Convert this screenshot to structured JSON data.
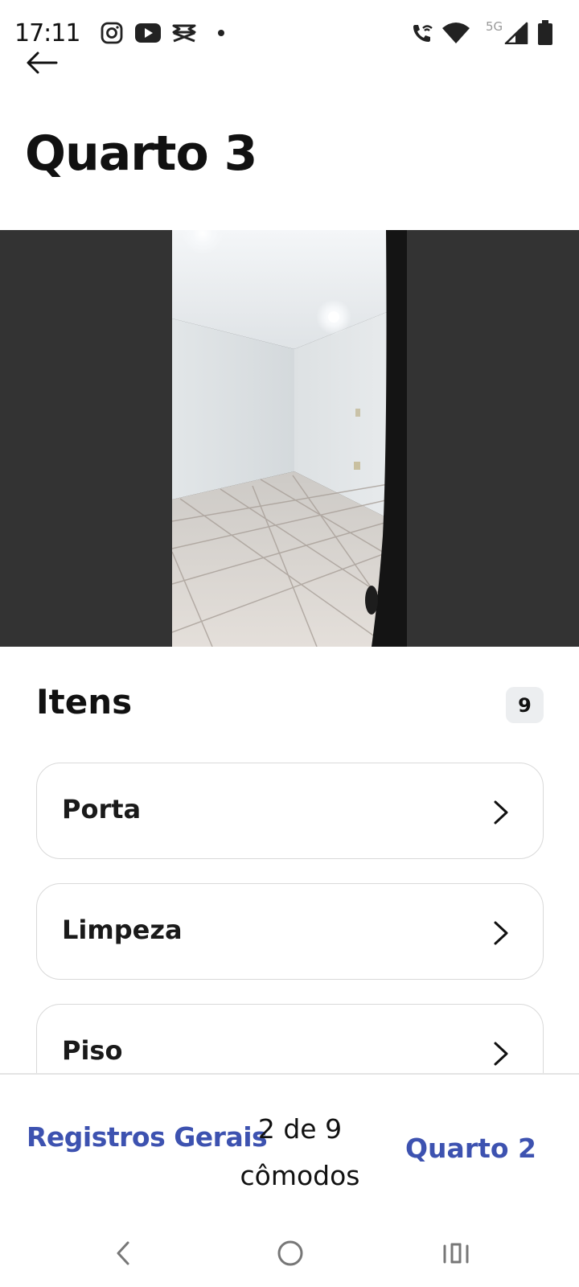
{
  "status_bar": {
    "time": "17:11",
    "network": "5G",
    "left_icons": [
      "instagram-icon",
      "youtube-icon",
      "capcut-icon",
      "notification-dot-icon"
    ],
    "right_icons": [
      "wifi-calling-icon",
      "wifi-icon",
      "signal-icon",
      "battery-icon"
    ]
  },
  "header": {
    "back_icon": "arrow-left-icon",
    "title": "Quarto 3"
  },
  "photo": {
    "description_icon": "room-photo",
    "background_color": "#333333"
  },
  "items_section": {
    "title": "Itens",
    "count": "9",
    "items": [
      {
        "label": "Porta"
      },
      {
        "label": "Limpeza"
      },
      {
        "label": "Piso"
      }
    ]
  },
  "footer_nav": {
    "prev_label": "Registros Gerais",
    "progress_line1": "2 de 9",
    "progress_line2": "cômodos",
    "next_label": "Quarto 2",
    "link_color": "#3d52b0"
  },
  "system_nav": {
    "icons": [
      "back-chevron-icon",
      "home-circle-icon",
      "recents-icon"
    ]
  }
}
